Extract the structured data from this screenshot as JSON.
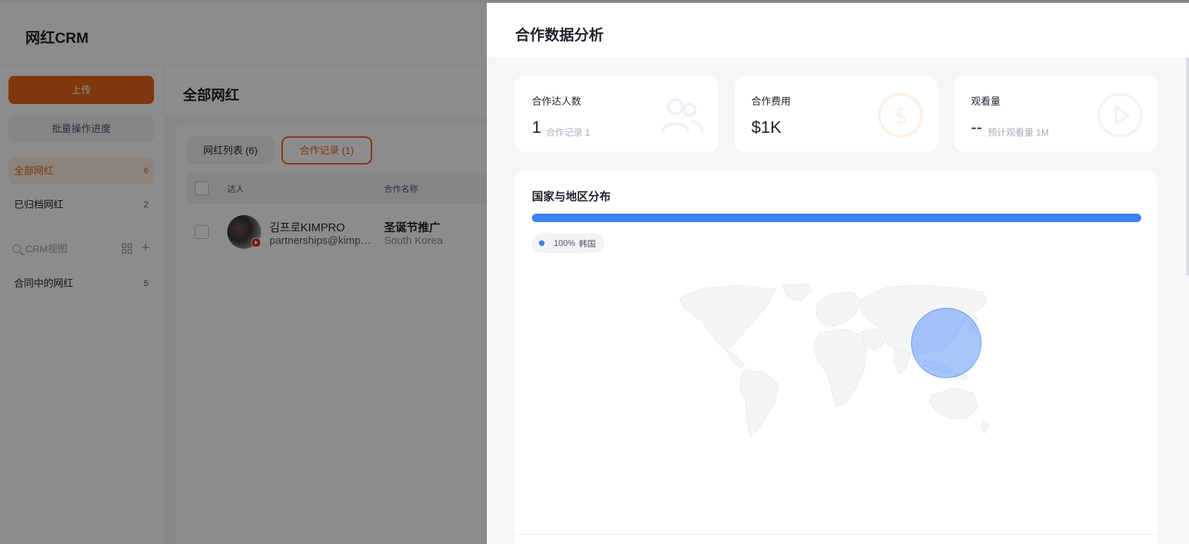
{
  "app": {
    "title": "网红CRM",
    "upload_label": "上传",
    "batch_label": "批量操作进度",
    "sidebar": {
      "items": [
        {
          "label": "全部网红",
          "count": "6",
          "active": true
        },
        {
          "label": "已归档网红",
          "count": "2",
          "active": false
        }
      ],
      "search_placeholder": "CRM视图",
      "views": [
        {
          "label": "合同中的网红",
          "count": "5"
        }
      ]
    },
    "main": {
      "title": "全部网红",
      "tabs": [
        {
          "label": "网红列表 (6)",
          "active": false
        },
        {
          "label": "合作记录 (1)",
          "active": true
        }
      ],
      "table": {
        "headers": [
          "达人",
          "合作名称"
        ],
        "rows": [
          {
            "name": "김프로KIMPRO",
            "email": "partnerships@kimp…",
            "coop_name": "圣诞节推广",
            "country": "South Korea",
            "platform_icon": "youtube-icon"
          }
        ]
      }
    }
  },
  "drawer": {
    "title": "合作数据分析",
    "stats": [
      {
        "label": "合作达人数",
        "value": "1",
        "sub": "合作记录 1",
        "icon": "users-icon"
      },
      {
        "label": "合作费用",
        "value": "$1K",
        "sub": "",
        "icon": "dollar-icon"
      },
      {
        "label": "观看量",
        "value": "--",
        "sub": "预计观看量 1M",
        "icon": "play-icon"
      }
    ],
    "distribution": {
      "title": "国家与地区分布",
      "legend": {
        "percent": "100%",
        "country": "韩国"
      },
      "share": 1.0,
      "color": "#3b82f6"
    }
  },
  "colors": {
    "accent": "#e8651a",
    "primary_blue": "#3b82f6"
  }
}
